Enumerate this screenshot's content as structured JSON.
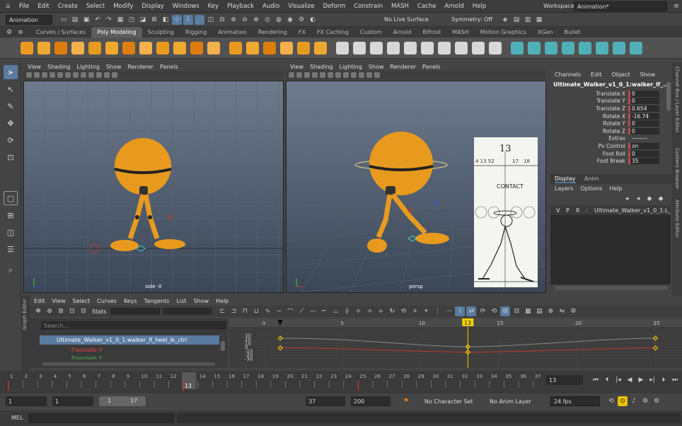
{
  "menubar": {
    "items": [
      "File",
      "Edit",
      "Create",
      "Select",
      "Modify",
      "Display",
      "Windows",
      "Key",
      "Playback",
      "Audio",
      "Visualize",
      "Deform",
      "Constrain",
      "MASH",
      "Cache",
      "Arnold",
      "Help"
    ],
    "workspace_label": "Workspace:",
    "workspace_value": "Animation*"
  },
  "statusline": {
    "menuset": "Animation",
    "live_surface": "No Live Surface",
    "symmetry": "Symmetry: Off"
  },
  "shelf": {
    "tabs": [
      "Curves / Surfaces",
      "Poly Modeling",
      "Sculpting",
      "Rigging",
      "Animation",
      "Rendering",
      "FX",
      "FX Caching",
      "Custom",
      "Arnold",
      "Bifrost",
      "MASH",
      "Motion Graphics",
      "XGen",
      "Bullet"
    ],
    "active_tab": "Poly Modeling"
  },
  "viewport_menu": [
    "View",
    "Shading",
    "Lighting",
    "Show",
    "Renderer",
    "Panels"
  ],
  "viewports": {
    "left_label": "side -X",
    "right_label": "persp"
  },
  "reference": {
    "frame": "13",
    "label": "CONTACT",
    "marks": [
      "4 13 52",
      "17",
      "18"
    ]
  },
  "channelbox": {
    "menu": [
      "Channels",
      "Edit",
      "Object",
      "Show"
    ],
    "object": "Ultimate_Walker_v1_0_1:walker_lf_...",
    "attributes": [
      {
        "name": "Translate X",
        "value": "0"
      },
      {
        "name": "Translate Y",
        "value": "0"
      },
      {
        "name": "Translate Z",
        "value": "0.654"
      },
      {
        "name": "Rotate X",
        "value": "-16.74"
      },
      {
        "name": "Rotate Y",
        "value": "0"
      },
      {
        "name": "Rotate Z",
        "value": "0"
      },
      {
        "name": "Extras",
        "value": "--------"
      },
      {
        "name": "Pv Control",
        "value": "on"
      },
      {
        "name": "Foot Roll",
        "value": "0"
      },
      {
        "name": "Foot Break",
        "value": "35"
      }
    ],
    "side_tabs": [
      "Channel Box / Layer Editor",
      "Content Browser",
      "Attribute Editor"
    ]
  },
  "layer_editor": {
    "tabs": [
      "Display",
      "Anim"
    ],
    "menu": [
      "Layers",
      "Options",
      "Help"
    ],
    "layer_flags": [
      "V",
      "P",
      "R"
    ],
    "layer_name": "Ultimate_Walker_v1_0_1:L_Ob"
  },
  "graph_editor": {
    "title": "Graph Editor",
    "menu": [
      "Edit",
      "View",
      "Select",
      "Curves",
      "Keys",
      "Tangents",
      "List",
      "Show",
      "Help"
    ],
    "stats_label": "Stats",
    "search_placeholder": "Search...",
    "outliner_item": "Ultimate_Walker_v1_0_1:walker_lf_heel_ik_ctrl",
    "channels": [
      "Translate X",
      "Translate Y"
    ],
    "frame_ticks": [
      "0",
      "5",
      "10",
      "15",
      "20",
      "25"
    ],
    "value_ticks": [
      "30",
      "20",
      "10",
      "0",
      "-10",
      "-20",
      "-30"
    ],
    "current_frame": "13"
  },
  "timeline": {
    "ticks": [
      "1",
      "2",
      "3",
      "4",
      "5",
      "6",
      "7",
      "8",
      "9",
      "10",
      "11",
      "12",
      "13",
      "14",
      "15",
      "16",
      "17",
      "18",
      "19",
      "20",
      "21",
      "22",
      "23",
      "24",
      "25",
      "26",
      "27",
      "28",
      "29",
      "30",
      "31",
      "32",
      "33",
      "34",
      "35",
      "36",
      "37"
    ],
    "current_frame": "13",
    "frame_field": "13"
  },
  "range": {
    "start": "1",
    "anim_start": "1",
    "slider_start": "1",
    "slider_end": "37",
    "end": "37",
    "anim_end": "200",
    "character_set": "No Character Set",
    "anim_layer": "No Anim Layer",
    "fps": "24 fps"
  },
  "cmdline": {
    "label": "MEL"
  },
  "colors": {
    "accent": "#5a7ba0",
    "keyframe": "#f5d000",
    "channel_red": "#c24b4b",
    "character": "#e89a1e"
  }
}
